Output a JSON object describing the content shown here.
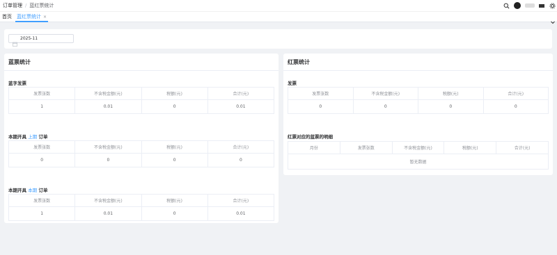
{
  "header": {
    "breadcrumb": [
      "订单管理",
      "蓝红票统计"
    ],
    "icons": [
      "search-icon",
      "avatar",
      "user-name",
      "settings-icon"
    ]
  },
  "tags": {
    "home_label": "首页",
    "active_label": "蓝红票统计",
    "close_glyph": "×"
  },
  "filter": {
    "month_value": "2025-11"
  },
  "blue": {
    "title": "蓝票统计",
    "columns": [
      "发票张数",
      "不含税金额(元)",
      "税额(元)",
      "合计(元)"
    ],
    "sections": [
      {
        "title_prefix": "蓝字发票",
        "highlight": "",
        "title_suffix": "",
        "row": [
          "1",
          "0.01",
          "0",
          "0.01"
        ]
      },
      {
        "title_prefix": "本期开具",
        "highlight": "上期",
        "title_suffix": "订单",
        "row": [
          "0",
          "0",
          "0",
          "0"
        ]
      },
      {
        "title_prefix": "本期开具",
        "highlight": "本期",
        "title_suffix": "订单",
        "row": [
          "1",
          "0.01",
          "0",
          "0.01"
        ]
      }
    ]
  },
  "red": {
    "title": "红票统计",
    "invoice_section": {
      "title": "发票",
      "columns": [
        "发票张数",
        "不含税金额(元)",
        "税额(元)",
        "合计(元)"
      ],
      "row": [
        "0",
        "0",
        "0",
        "0"
      ]
    },
    "detail_section": {
      "title": "红票对应的蓝票的明细",
      "columns": [
        "月份",
        "发票张数",
        "不含税金额(元)",
        "税额(元)",
        "合计(元)"
      ],
      "empty_text": "暂无数据"
    }
  },
  "colors": {
    "accent": "#409eff",
    "background": "#f0f2f5",
    "border": "#ebeef5"
  }
}
